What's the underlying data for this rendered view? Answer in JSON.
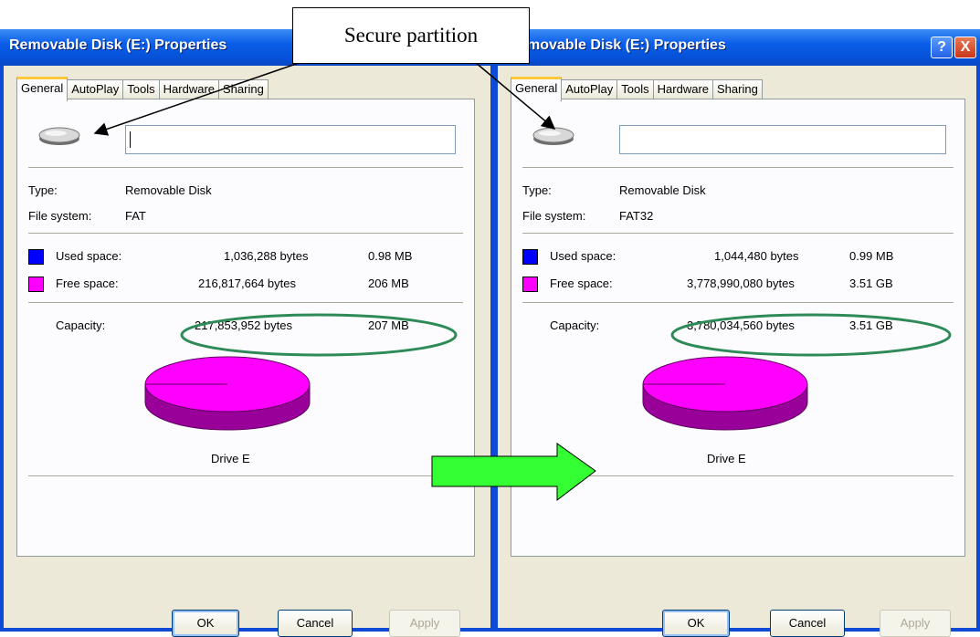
{
  "callout": {
    "text": "Secure partition"
  },
  "windows": [
    {
      "title": "Removable Disk (E:) Properties",
      "tabs": [
        "General",
        "AutoPlay",
        "Tools",
        "Hardware",
        "Sharing"
      ],
      "type_label": "Type:",
      "type_value": "Removable Disk",
      "fs_label": "File system:",
      "fs_value": "FAT",
      "used_label": "Used space:",
      "used_bytes": "1,036,288 bytes",
      "used_size": "0.98 MB",
      "free_label": "Free space:",
      "free_bytes": "216,817,664 bytes",
      "free_size": "206 MB",
      "cap_label": "Capacity:",
      "cap_bytes": "217,853,952 bytes",
      "cap_size": "207 MB",
      "drive_label": "Drive E",
      "ok": "OK",
      "cancel": "Cancel",
      "apply": "Apply"
    },
    {
      "title": "movable Disk (E:) Properties",
      "tabs": [
        "General",
        "AutoPlay",
        "Tools",
        "Hardware",
        "Sharing"
      ],
      "type_label": "Type:",
      "type_value": "Removable Disk",
      "fs_label": "File system:",
      "fs_value": "FAT32",
      "used_label": "Used space:",
      "used_bytes": "1,044,480 bytes",
      "used_size": "0.99 MB",
      "free_label": "Free space:",
      "free_bytes": "3,778,990,080 bytes",
      "free_size": "3.51 GB",
      "cap_label": "Capacity:",
      "cap_bytes": "3,780,034,560 bytes",
      "cap_size": "3.51 GB",
      "drive_label": "Drive E",
      "ok": "OK",
      "cancel": "Cancel",
      "apply": "Apply",
      "help_glyph": "?",
      "close_glyph": "X"
    }
  ],
  "colors": {
    "used": "#0000ff",
    "free": "#ff00ff",
    "highlight_ellipse": "#2e8b57",
    "arrow": "#33ff33"
  }
}
